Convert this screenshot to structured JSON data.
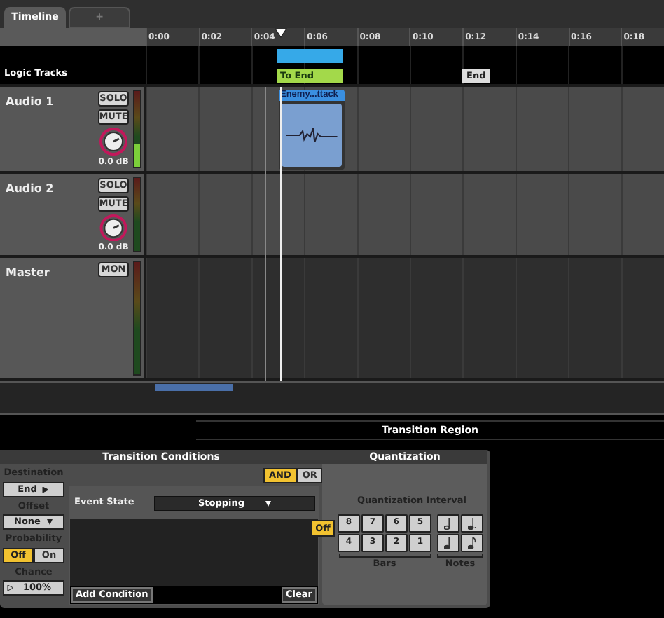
{
  "tabs": [
    {
      "label": "Timeline",
      "selected": true
    },
    {
      "label": "+",
      "selected": false
    }
  ],
  "ruler": [
    "0:00",
    "0:02",
    "0:04",
    "0:06",
    "0:08",
    "0:10",
    "0:12",
    "0:14",
    "0:16",
    "0:18"
  ],
  "logic_tracks": {
    "label": "Logic Tracks",
    "transition_label": "To End",
    "marker": "End"
  },
  "tracks": [
    {
      "kind": "audio",
      "name": "Audio 1",
      "solo": "SOLO",
      "mute": "MUTE",
      "reading": "0.0 dB",
      "level": 0.3,
      "clip": "Enemy...ttack"
    },
    {
      "kind": "audio",
      "name": "Audio 2",
      "solo": "SOLO",
      "mute": "MUTE",
      "reading": "0.0 dB"
    },
    {
      "kind": "master",
      "name": "Master",
      "mon": "MON"
    }
  ],
  "transition_region": {
    "title": "Transition Region",
    "destination": {
      "label": "Destination",
      "value": "End",
      "offset_label": "Offset",
      "offset": "None"
    },
    "probability": {
      "label": "Probability",
      "options": [
        {
          "label": "Off",
          "selected": true
        },
        {
          "label": "On",
          "selected": false
        }
      ],
      "chance_label": "Chance",
      "chance": "100%"
    },
    "conditions": {
      "title": "Transition Conditions",
      "logic": [
        {
          "label": "AND",
          "selected": true
        },
        {
          "label": "OR",
          "selected": false
        }
      ],
      "rows": [
        {
          "name": "Event State",
          "value": "Stopping"
        }
      ],
      "add": "Add Condition",
      "clear": "Clear"
    },
    "quantization": {
      "title": "Quantization",
      "interval_label": "Quantization Interval",
      "off": {
        "label": "Off",
        "selected": true
      },
      "bars": [
        {
          "label": "8",
          "selected": false
        },
        {
          "label": "7",
          "selected": false
        },
        {
          "label": "6",
          "selected": false
        },
        {
          "label": "5",
          "selected": false
        },
        {
          "label": "4",
          "selected": false
        },
        {
          "label": "3",
          "selected": false
        },
        {
          "label": "2",
          "selected": false
        },
        {
          "label": "1",
          "selected": false
        }
      ],
      "bars_label": "Bars",
      "notes_label": "Notes"
    }
  }
}
